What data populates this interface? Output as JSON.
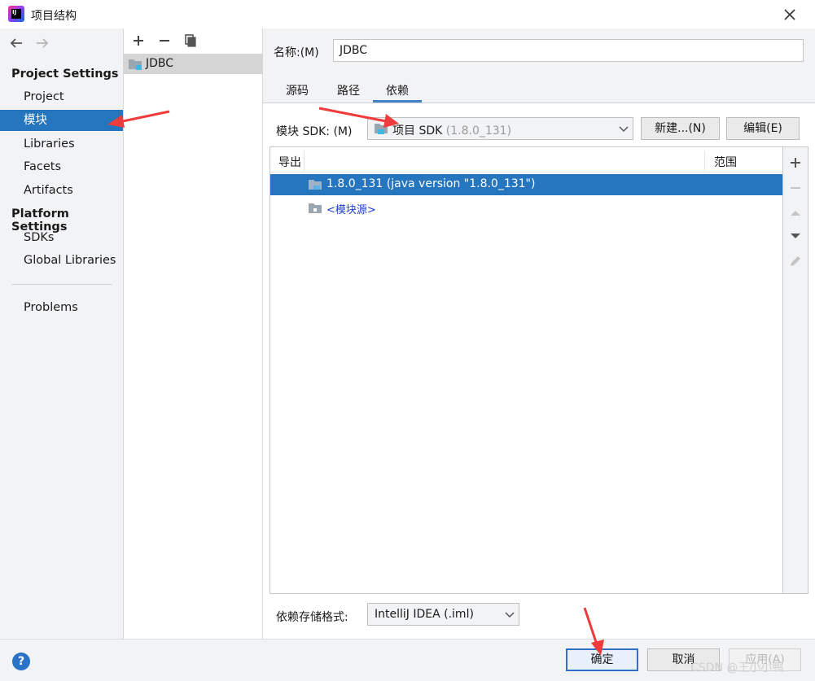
{
  "window": {
    "title": "项目结构",
    "logo_text": "IJ",
    "colors": {
      "accent": "#2675bf",
      "panel": "#f2f3f5",
      "annotation": "#ee3b3b"
    }
  },
  "nav": {
    "project_settings_header": "Project Settings",
    "platform_settings_header": "Platform Settings",
    "items": [
      {
        "label": "Project"
      },
      {
        "label": "模块",
        "selected": true
      },
      {
        "label": "Libraries"
      },
      {
        "label": "Facets"
      },
      {
        "label": "Artifacts"
      },
      {
        "label": "SDKs"
      },
      {
        "label": "Global Libraries"
      },
      {
        "label": "Problems"
      }
    ]
  },
  "modules": {
    "list": [
      {
        "label": "JDBC",
        "selected": true
      }
    ]
  },
  "detail": {
    "name_label": "名称:(M)",
    "name_value": "JDBC",
    "tabs": [
      {
        "label": "源码"
      },
      {
        "label": "路径"
      },
      {
        "label": "依赖",
        "active": true
      }
    ],
    "sdk_label": "模块 SDK:",
    "sdk_mnemonic": "(M)",
    "sdk_value": "项目 SDK",
    "sdk_version": "(1.8.0_131)",
    "new_button": "新建...(N)",
    "edit_button": "编辑(E)",
    "table": {
      "col_export": "导出",
      "col_scope": "范围",
      "rows": [
        {
          "label": "1.8.0_131 (java version \"1.8.0_131\")",
          "selected": true,
          "icon": "folder-icon"
        },
        {
          "label": "<模块源>",
          "selected": false,
          "icon": "folder-icon"
        }
      ]
    },
    "format_label": "依赖存储格式:",
    "format_value": "IntelliJ IDEA (.iml)"
  },
  "footer": {
    "help": "?",
    "ok": "确定",
    "cancel": "取消",
    "apply": "应用(A)",
    "watermark": "CSDN @王小小鸭"
  }
}
